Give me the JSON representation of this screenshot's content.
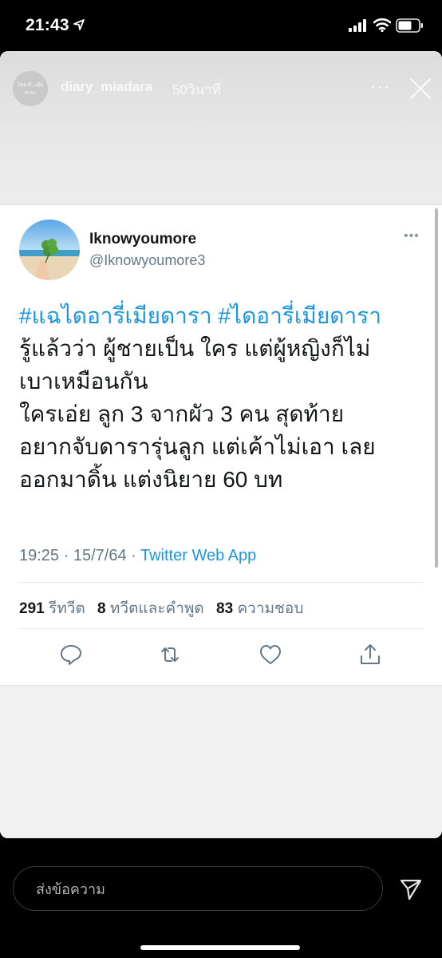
{
  "status_bar": {
    "time": "21:43",
    "icons": [
      "location-arrow-icon",
      "cellular-signal-icon",
      "wifi-icon",
      "battery-icon"
    ]
  },
  "story": {
    "avatar_text": "ไดอารี่...เมียดารา",
    "username": "diary_miadara",
    "time_ago": "50วินาที",
    "more_label": "···",
    "icons": [
      "more-options-icon",
      "close-icon"
    ]
  },
  "tweet": {
    "display_name": "Iknowyoumore",
    "handle": "@Iknowyoumore3",
    "more_label": "•••",
    "hashtags": [
      "#แฉไดอารี่เมียดารา",
      "#ไดอารี่เมียดารา"
    ],
    "lines": [
      "รู้แล้วว่า ผู้ชายเป็น ใคร แต่ผู้หญิงก็ไม่",
      "เบาเหมือนกัน",
      "ใครเอ่ย ลูก 3 จากผัว 3 คน สุดท้าย",
      "อยากจับดารารุ่นลูก แต่เค้าไม่เอา เลย",
      "ออกมาดิ้น แต่งนิยาย 60 บท"
    ],
    "time": "19:25",
    "date": "15/7/64",
    "separator": " · ",
    "source": "Twitter Web App",
    "stats": {
      "retweets_count": "291",
      "retweets_label": "รีทวีต",
      "quotes_count": "8",
      "quotes_label": "ทวีตและคำพูด",
      "likes_count": "83",
      "likes_label": "ความชอบ"
    },
    "action_icons": [
      "reply-icon",
      "retweet-icon",
      "like-icon",
      "share-icon"
    ]
  },
  "reply_bar": {
    "placeholder": "ส่งข้อความ",
    "icons": [
      "send-icon"
    ]
  },
  "colors": {
    "background": "#000000",
    "link_blue": "#1b95e0",
    "secondary_text": "#657786",
    "primary_text": "#14171a"
  }
}
